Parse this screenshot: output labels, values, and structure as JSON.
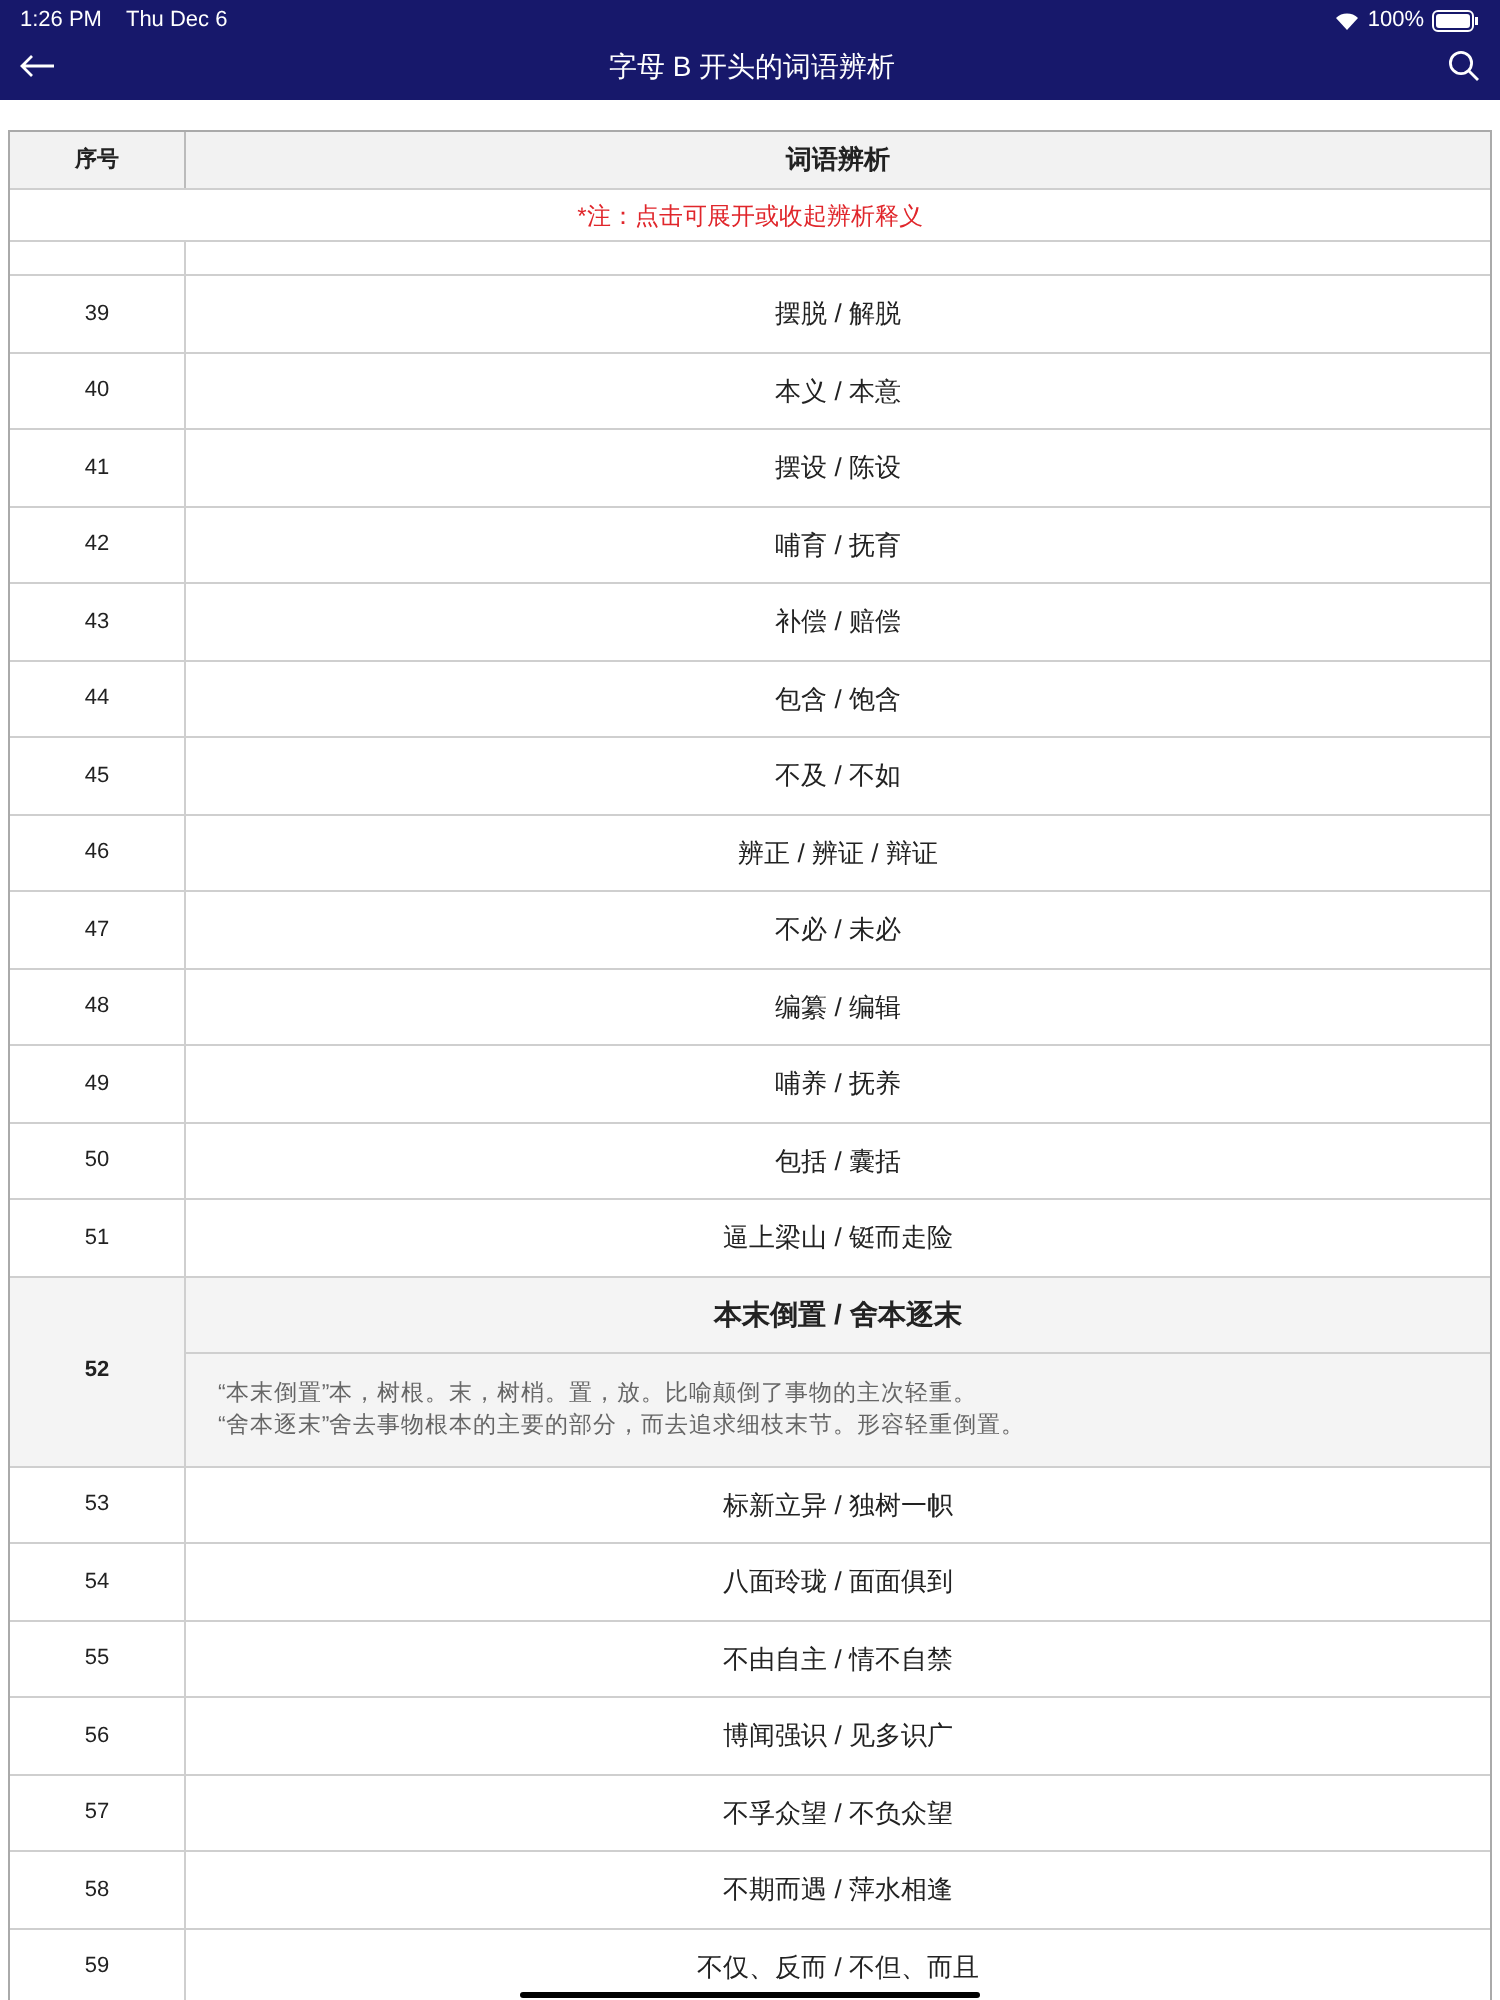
{
  "status_bar": {
    "time": "1:26 PM",
    "date": "Thu Dec 6",
    "battery": "100%"
  },
  "nav": {
    "title": "字母 B 开头的词语辨析"
  },
  "table": {
    "columns": [
      "序号",
      "词语辨析"
    ],
    "note": "*注：点击可展开或收起辨析释义",
    "rows": [
      {
        "index": "39",
        "title": "摆脱 / 解脱",
        "expanded": false
      },
      {
        "index": "40",
        "title": "本义 / 本意",
        "expanded": false
      },
      {
        "index": "41",
        "title": "摆设 / 陈设",
        "expanded": false
      },
      {
        "index": "42",
        "title": "哺育 / 抚育",
        "expanded": false
      },
      {
        "index": "43",
        "title": "补偿 / 赔偿",
        "expanded": false
      },
      {
        "index": "44",
        "title": "包含 / 饱含",
        "expanded": false
      },
      {
        "index": "45",
        "title": "不及 / 不如",
        "expanded": false
      },
      {
        "index": "46",
        "title": "辨正 / 辨证 / 辩证",
        "expanded": false
      },
      {
        "index": "47",
        "title": "不必 / 未必",
        "expanded": false
      },
      {
        "index": "48",
        "title": "编纂 / 编辑",
        "expanded": false
      },
      {
        "index": "49",
        "title": "哺养 / 抚养",
        "expanded": false
      },
      {
        "index": "50",
        "title": "包括 / 囊括",
        "expanded": false
      },
      {
        "index": "51",
        "title": "逼上梁山 / 铤而走险",
        "expanded": false
      },
      {
        "index": "52",
        "title": "本末倒置 / 舍本逐末",
        "expanded": true,
        "detail_lines": [
          "“本末倒置”本，树根。末，树梢。置，放。比喻颠倒了事物的主次轻重。",
          "“舍本逐末”舍去事物根本的主要的部分，而去追求细枝末节。形容轻重倒置。"
        ]
      },
      {
        "index": "53",
        "title": "标新立异 / 独树一帜",
        "expanded": false
      },
      {
        "index": "54",
        "title": "八面玲珑 / 面面俱到",
        "expanded": false
      },
      {
        "index": "55",
        "title": "不由自主 / 情不自禁",
        "expanded": false
      },
      {
        "index": "56",
        "title": "博闻强识 / 见多识广",
        "expanded": false
      },
      {
        "index": "57",
        "title": "不孚众望 / 不负众望",
        "expanded": false
      },
      {
        "index": "58",
        "title": "不期而遇 / 萍水相逢",
        "expanded": false
      },
      {
        "index": "59",
        "title": "不仅、反而 / 不但、而且",
        "expanded": false
      }
    ]
  }
}
